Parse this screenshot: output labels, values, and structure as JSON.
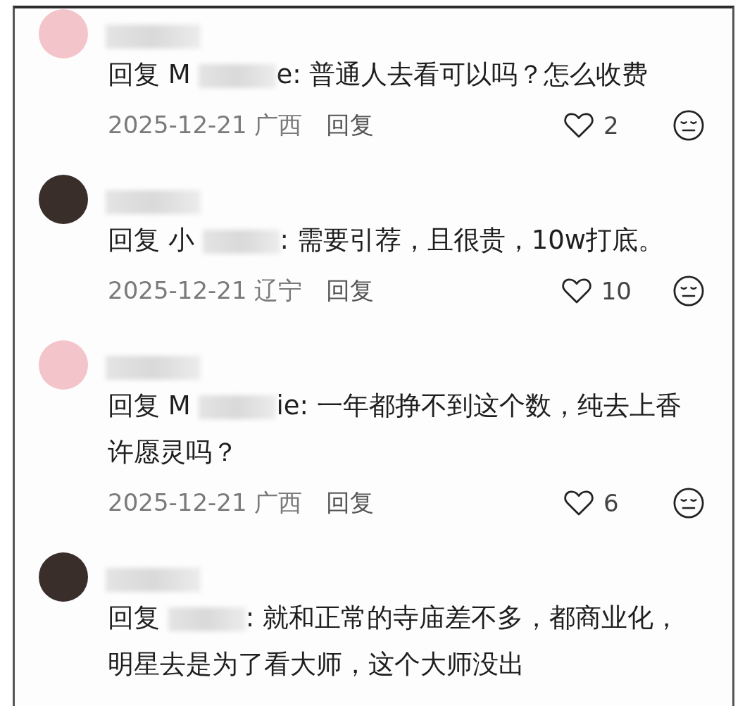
{
  "comments": [
    {
      "avatar": {
        "color": "#f4c4cb"
      },
      "reply_prefix": "回复 M",
      "reply_text": "e: 普通人去看可以吗？怎么收费",
      "date": "2025-12-21",
      "location": "广西",
      "reply_button": "回复",
      "likes": "2"
    },
    {
      "avatar": {
        "color": "#3a2e2a"
      },
      "reply_prefix": "回复 小",
      "reply_text": ": 需要引荐，且很贵，10w打底。",
      "date": "2025-12-21",
      "location": "辽宁",
      "reply_button": "回复",
      "likes": "10"
    },
    {
      "avatar": {
        "color": "#f4c4cb"
      },
      "reply_prefix": "回复 M",
      "reply_text": "ie: 一年都挣不到这个数，纯去上香许愿灵吗？",
      "date": "2025-12-21",
      "location": "广西",
      "reply_button": "回复",
      "likes": "6"
    },
    {
      "avatar": {
        "color": "#3a2e2a"
      },
      "reply_prefix": "回复",
      "reply_text": ": 就和正常的寺庙差不多，都商业化，明星去是为了看大师，这个大师没出"
    }
  ]
}
